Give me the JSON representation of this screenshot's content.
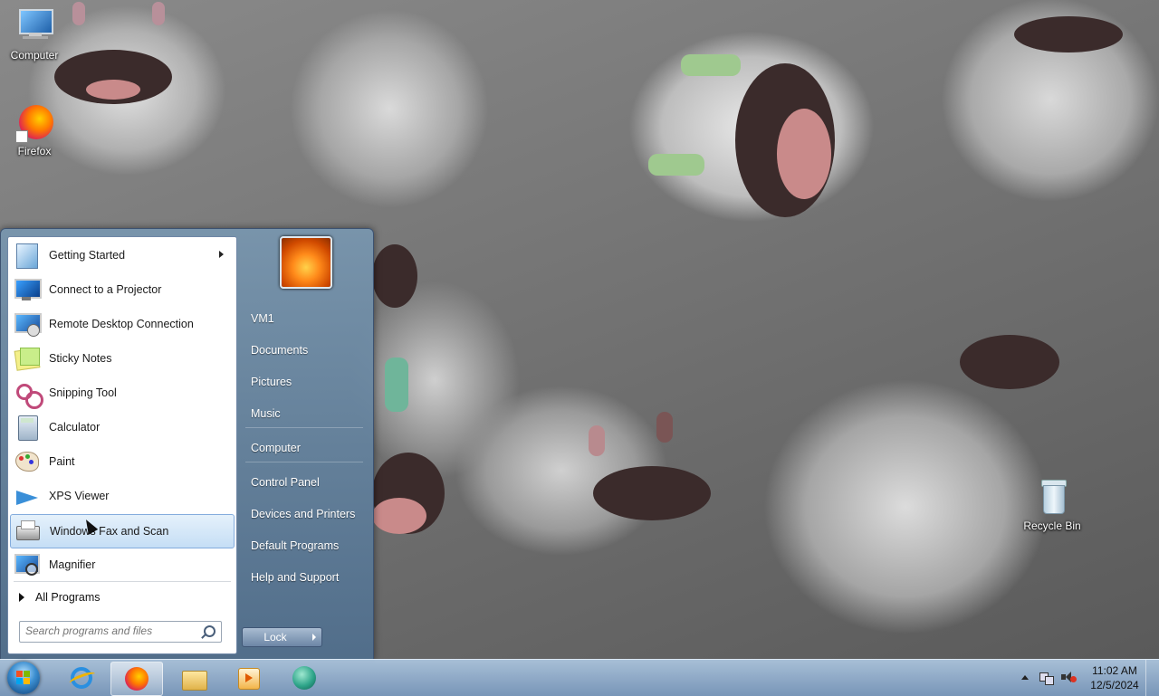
{
  "desktop": {
    "icons": [
      {
        "label": "Computer",
        "icon": "computer-icon"
      },
      {
        "label": "Firefox",
        "icon": "firefox-icon"
      },
      {
        "label": "Recycle Bin",
        "icon": "recycle-bin-icon"
      }
    ]
  },
  "start_menu": {
    "programs": [
      {
        "label": "Getting Started",
        "icon": "getting-started-icon",
        "has_submenu": true
      },
      {
        "label": "Connect to a Projector",
        "icon": "projector-icon"
      },
      {
        "label": "Remote Desktop Connection",
        "icon": "remote-desktop-icon"
      },
      {
        "label": "Sticky Notes",
        "icon": "sticky-notes-icon"
      },
      {
        "label": "Snipping Tool",
        "icon": "snipping-tool-icon"
      },
      {
        "label": "Calculator",
        "icon": "calculator-icon"
      },
      {
        "label": "Paint",
        "icon": "paint-icon"
      },
      {
        "label": "XPS Viewer",
        "icon": "xps-viewer-icon"
      },
      {
        "label": "Windows Fax and Scan",
        "icon": "fax-scan-icon",
        "highlighted": true
      },
      {
        "label": "Magnifier",
        "icon": "magnifier-icon"
      }
    ],
    "all_programs": "All Programs",
    "search_placeholder": "Search programs and files",
    "right_items": [
      "VM1",
      "Documents",
      "Pictures",
      "Music",
      "Computer",
      "Control Panel",
      "Devices and Printers",
      "Default Programs",
      "Help and Support"
    ],
    "lock_label": "Lock"
  },
  "taskbar": {
    "pinned": [
      {
        "name": "internet-explorer-icon"
      },
      {
        "name": "firefox-icon",
        "active": true
      },
      {
        "name": "file-explorer-icon"
      },
      {
        "name": "media-player-icon"
      },
      {
        "name": "app-globe-icon"
      }
    ],
    "clock": {
      "time": "11:02 AM",
      "date": "12/5/2024"
    }
  },
  "colors": {
    "taskbar": "#8aa6c6",
    "menu_highlight": "#c5def5",
    "accent": "#3b8ed0"
  }
}
